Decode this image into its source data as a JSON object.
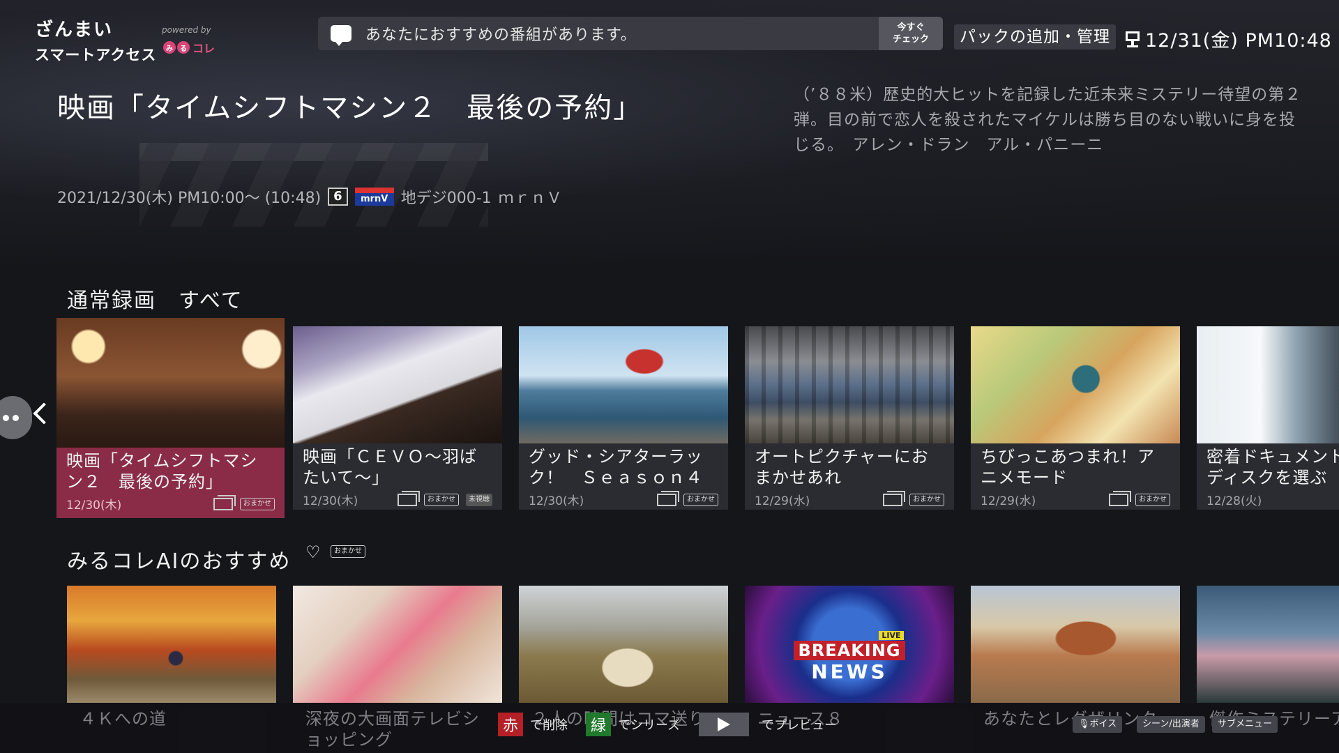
{
  "brand": {
    "line1": "ざんまい",
    "line2": "スマートアクセス",
    "powered_by": "powered by",
    "logo_text": "コレ",
    "logo_dot1": "み",
    "logo_dot2": "る"
  },
  "notification": {
    "text": "あなたにおすすめの番組があります。",
    "check_label": "今すぐ\nチェック"
  },
  "pack_button": "パックの追加・管理",
  "clock": "12/31(金) PM10:48",
  "program": {
    "title": "映画「タイムシフトマシン２　最後の予約」",
    "description": "（’８８米）歴史的大ヒットを記録した近未来ミステリー待望の第２弾。目の前で恋人を殺されたマイケルは勝ち目のない戦いに身を投じる。　アレン・ドラン　アル・パニーニ",
    "airtime": "2021/12/30(木) PM10:00～ (10:48)",
    "channel_number": "6",
    "channel_logo": "mrnV",
    "channel": "地デジ000-1",
    "channel_name": "ｍｒｎＶ"
  },
  "sections": {
    "recordings_title": "通常録画　すべて",
    "recommend_title": "みるコレAIのおすすめ",
    "recommend_tag": "おまかせ"
  },
  "recordings": [
    {
      "title": "映画「タイムシフトマシン２　最後の予約」",
      "date": "12/30(木)",
      "tag": "おまかせ",
      "unwatched": ""
    },
    {
      "title": "映画「ＣＥＶＯ～羽ばたいて～」",
      "date": "12/30(木)",
      "tag": "おまかせ",
      "unwatched": "未視聴"
    },
    {
      "title": "グッド・シアターラック！　Ｓｅａｓｏｎ４",
      "date": "12/30(木)",
      "tag": "おまかせ",
      "unwatched": ""
    },
    {
      "title": "オートピクチャーにおまかせあれ",
      "date": "12/29(水)",
      "tag": "おまかせ",
      "unwatched": ""
    },
    {
      "title": "ちびっこあつまれ！アニメモード",
      "date": "12/29(水)",
      "tag": "おまかせ",
      "unwatched": ""
    },
    {
      "title": "密着ドキュメント　ドディスクを選ぶ",
      "date": "12/28(火)",
      "tag": "",
      "unwatched": ""
    }
  ],
  "recommendations": [
    {
      "title": "４Ｋへの道"
    },
    {
      "title": "深夜の大画面テレビショッピング"
    },
    {
      "title": "２人の時間はコマ送り"
    },
    {
      "title": "ニュース８"
    },
    {
      "title": "あなたとレグザリンク"
    },
    {
      "title": "傑作ミステリーアワー甘噛家の華"
    }
  ],
  "breaking": {
    "live": "LIVE",
    "line1": "BREAKING",
    "line2": "NEWS"
  },
  "bottom_hints": {
    "red_key": "赤",
    "red_action": "で削除",
    "green_key": "緑",
    "green_action": "でシリーズ",
    "play_action": "でプレビュー",
    "voice": "🎙ボイス",
    "scene": "シーン/出演者",
    "submenu": "サブメニュー"
  },
  "colors": {
    "focus": "#8a2c48",
    "background": "#15161a",
    "red_key": "#b51f26",
    "green_key": "#1f7a2b"
  }
}
